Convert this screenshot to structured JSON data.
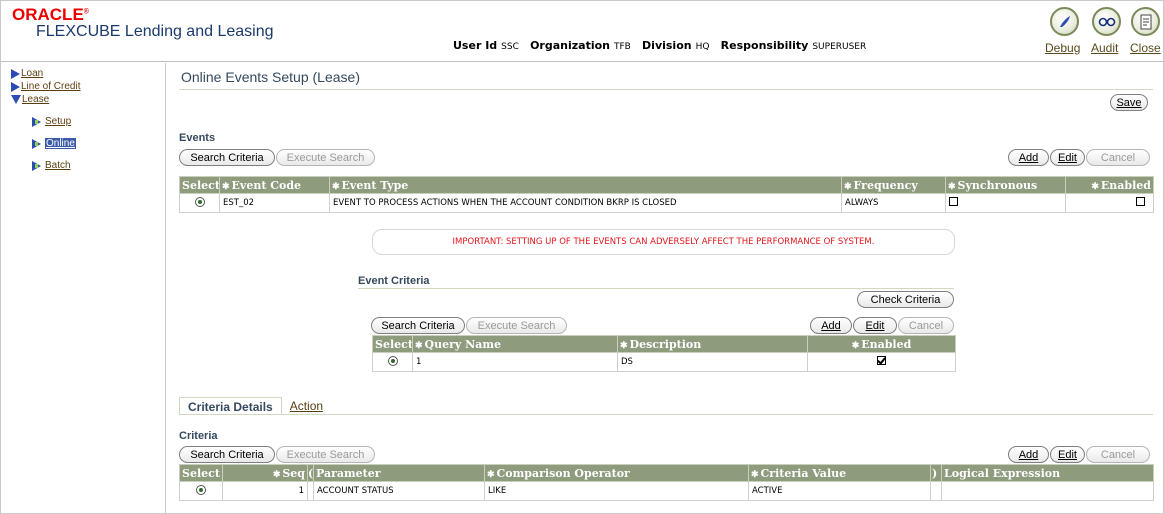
{
  "header": {
    "brand": "ORACLE",
    "brand_mark": "®",
    "product": "FLEXCUBE Lending and Leasing",
    "user_id_label": "User Id",
    "user_id_value": "SSC",
    "org_label": "Organization",
    "org_value": "TFB",
    "division_label": "Division",
    "division_value": "HQ",
    "resp_label": "Responsibility",
    "resp_value": "SUPERUSER",
    "debug": "Debug",
    "audit": "Audit",
    "close": "Close"
  },
  "nav": {
    "loan": "Loan",
    "line_of_credit": "Line of Credit",
    "lease": "Lease",
    "setup": "Setup",
    "online": "Online",
    "batch": "Batch"
  },
  "page": {
    "title": "Online Events Setup (Lease)",
    "save": "Save"
  },
  "events": {
    "section": "Events",
    "search": "Search Criteria",
    "execute": "Execute Search",
    "add": "Add",
    "edit": "Edit",
    "cancel": "Cancel",
    "columns": {
      "select": "Select",
      "code": "Event Code",
      "type": "Event Type",
      "frequency": "Frequency",
      "synchronous": "Synchronous",
      "enabled": "Enabled"
    },
    "rows": [
      {
        "code": "EST_02",
        "type": "EVENT TO PROCESS ACTIONS WHEN THE ACCOUNT CONDITION BKRP IS CLOSED",
        "frequency": "ALWAYS",
        "synchronous": false,
        "enabled": false
      }
    ]
  },
  "warning": "IMPORTANT: SETTING UP OF THE EVENTS CAN ADVERSELY AFFECT THE PERFORMANCE OF SYSTEM.",
  "event_criteria": {
    "section": "Event Criteria",
    "check": "Check Criteria",
    "search": "Search Criteria",
    "execute": "Execute Search",
    "add": "Add",
    "edit": "Edit",
    "cancel": "Cancel",
    "columns": {
      "select": "Select",
      "query": "Query Name",
      "description": "Description",
      "enabled": "Enabled"
    },
    "rows": [
      {
        "query": "1",
        "description": "DS",
        "enabled": true
      }
    ]
  },
  "tabs": {
    "criteria_details": "Criteria Details",
    "action": "Action"
  },
  "criteria": {
    "section": "Criteria",
    "search": "Search Criteria",
    "execute": "Execute Search",
    "add": "Add",
    "edit": "Edit",
    "cancel": "Cancel",
    "columns": {
      "select": "Select",
      "seq": "Seq",
      "open_paren": "(",
      "parameter": "Parameter",
      "operator": "Comparison Operator",
      "value": "Criteria Value",
      "close_paren": ")",
      "logical": "Logical Expression"
    },
    "rows": [
      {
        "seq": "1",
        "open_paren": "",
        "parameter": "ACCOUNT STATUS",
        "operator": "LIKE",
        "value": "ACTIVE",
        "close_paren": "",
        "logical": ""
      }
    ]
  }
}
